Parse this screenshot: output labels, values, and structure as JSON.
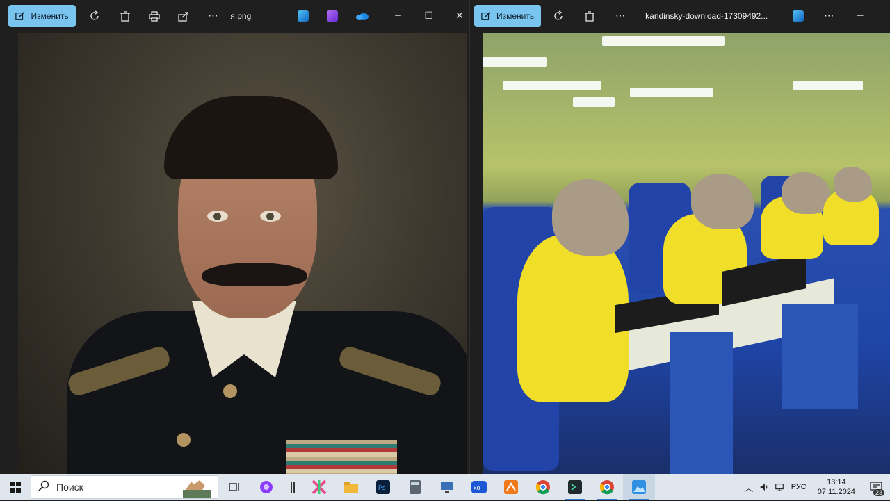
{
  "left_viewer": {
    "edit_label": "Изменить",
    "filename": "я.png",
    "more": "···"
  },
  "right_viewer": {
    "edit_label": "Изменить",
    "filename": "kandinsky-download-17309492...",
    "more": "···"
  },
  "taskbar": {
    "search_placeholder": "Поиск",
    "language": "РУС",
    "time": "13:14",
    "date": "07.11.2024",
    "notification_count": "23"
  },
  "colors": {
    "edit_button": "#7ac5f0",
    "taskbar": "#dfe6ee",
    "viewer_bg": "#1f1f1f"
  },
  "icons": [
    "rotate-icon",
    "trash-icon",
    "print-icon",
    "share-icon",
    "photos-app-icon",
    "clipchamp-icon",
    "onedrive-icon",
    "windows-start-icon",
    "search-icon",
    "task-view-icon",
    "alice-icon",
    "chrome-icon",
    "explorer-icon",
    "photoshop-icon",
    "calculator-icon"
  ]
}
